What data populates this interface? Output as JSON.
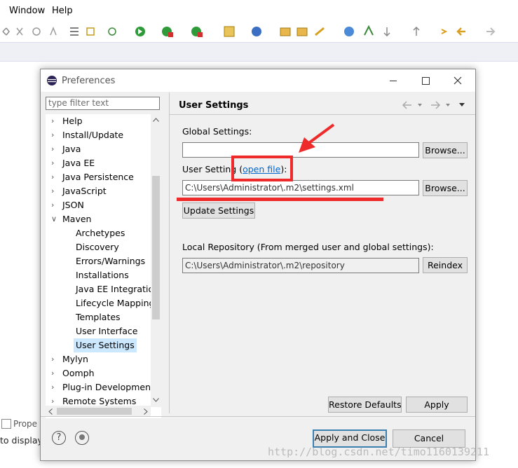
{
  "ide": {
    "menu": [
      "Window",
      "Help"
    ],
    "bottom_tab": "Prope",
    "bottom_text": "to display"
  },
  "dialog": {
    "title": "Preferences",
    "filter_placeholder": "type filter text",
    "tree": [
      {
        "label": "Help",
        "level": 0,
        "expanded": false
      },
      {
        "label": "Install/Update",
        "level": 0,
        "expanded": false
      },
      {
        "label": "Java",
        "level": 0,
        "expanded": false
      },
      {
        "label": "Java EE",
        "level": 0,
        "expanded": false
      },
      {
        "label": "Java Persistence",
        "level": 0,
        "expanded": false
      },
      {
        "label": "JavaScript",
        "level": 0,
        "expanded": false
      },
      {
        "label": "JSON",
        "level": 0,
        "expanded": false
      },
      {
        "label": "Maven",
        "level": 0,
        "expanded": true
      },
      {
        "label": "Archetypes",
        "level": 1
      },
      {
        "label": "Discovery",
        "level": 1
      },
      {
        "label": "Errors/Warnings",
        "level": 1
      },
      {
        "label": "Installations",
        "level": 1
      },
      {
        "label": "Java EE Integration",
        "level": 1
      },
      {
        "label": "Lifecycle Mapping",
        "level": 1
      },
      {
        "label": "Templates",
        "level": 1
      },
      {
        "label": "User Interface",
        "level": 1
      },
      {
        "label": "User Settings",
        "level": 1,
        "selected": true
      },
      {
        "label": "Mylyn",
        "level": 0,
        "expanded": false
      },
      {
        "label": "Oomph",
        "level": 0,
        "expanded": false
      },
      {
        "label": "Plug-in Development",
        "level": 0,
        "expanded": false
      },
      {
        "label": "Remote Systems",
        "level": 0,
        "expanded": false
      }
    ],
    "page": {
      "title": "User Settings",
      "global_settings_label": "Global Settings:",
      "global_settings_value": "",
      "browse_label": "Browse...",
      "user_setting_label": "User Setting",
      "open_file_link": "open file",
      "user_setting_value": "C:\\Users\\Administrator\\.m2\\settings.xml",
      "update_settings_label": "Update Settings",
      "local_repo_label": "Local Repository (From merged user and global settings):",
      "local_repo_value": "C:\\Users\\Administrator\\.m2\\repository",
      "reindex_label": "Reindex",
      "restore_defaults_label": "Restore Defaults",
      "apply_label": "Apply"
    },
    "footer": {
      "apply_close_label": "Apply and Close",
      "cancel_label": "Cancel"
    }
  },
  "watermark": "http://blog.csdn.net/timo1160139211",
  "colors": {
    "annotation": "#ee2a2a",
    "selection": "#cce8ff",
    "link": "#0066cc"
  }
}
